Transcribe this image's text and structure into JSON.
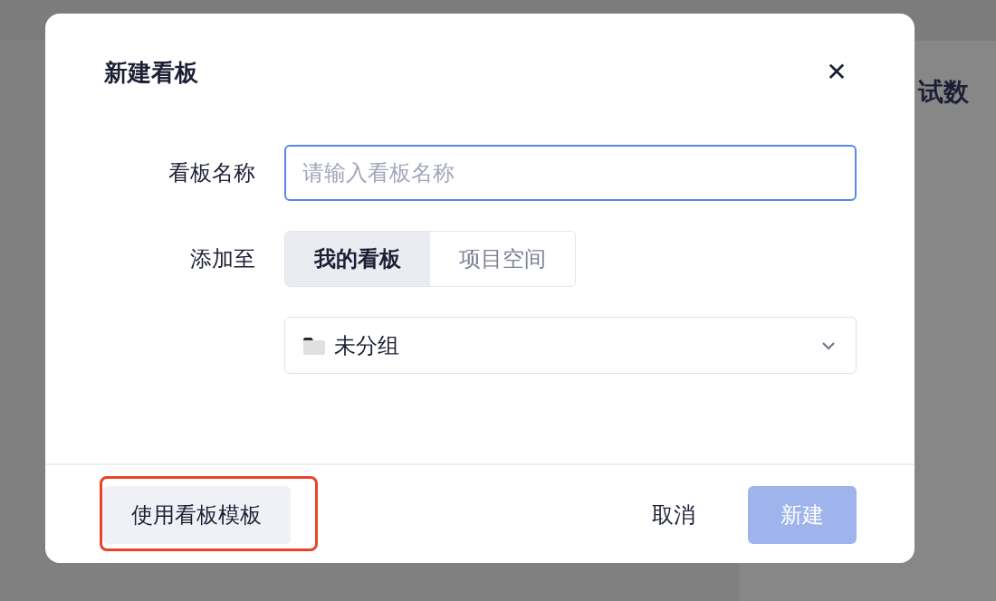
{
  "background": {
    "heading": "试数"
  },
  "dialog": {
    "title": "新建看板",
    "close": "✕",
    "name_field": {
      "label": "看板名称",
      "placeholder": "请输入看板名称",
      "focused": true
    },
    "target": {
      "label": "添加至",
      "options": [
        {
          "label": "我的看板",
          "selected": true
        },
        {
          "label": "项目空间",
          "selected": false
        }
      ]
    },
    "group_select": {
      "value": "未分组"
    },
    "footer": {
      "template_button": {
        "label": "使用看板模板",
        "highlighted": true
      },
      "cancel_button": {
        "label": "取消"
      },
      "create_button": {
        "label": "新建",
        "disabled": true
      }
    }
  }
}
